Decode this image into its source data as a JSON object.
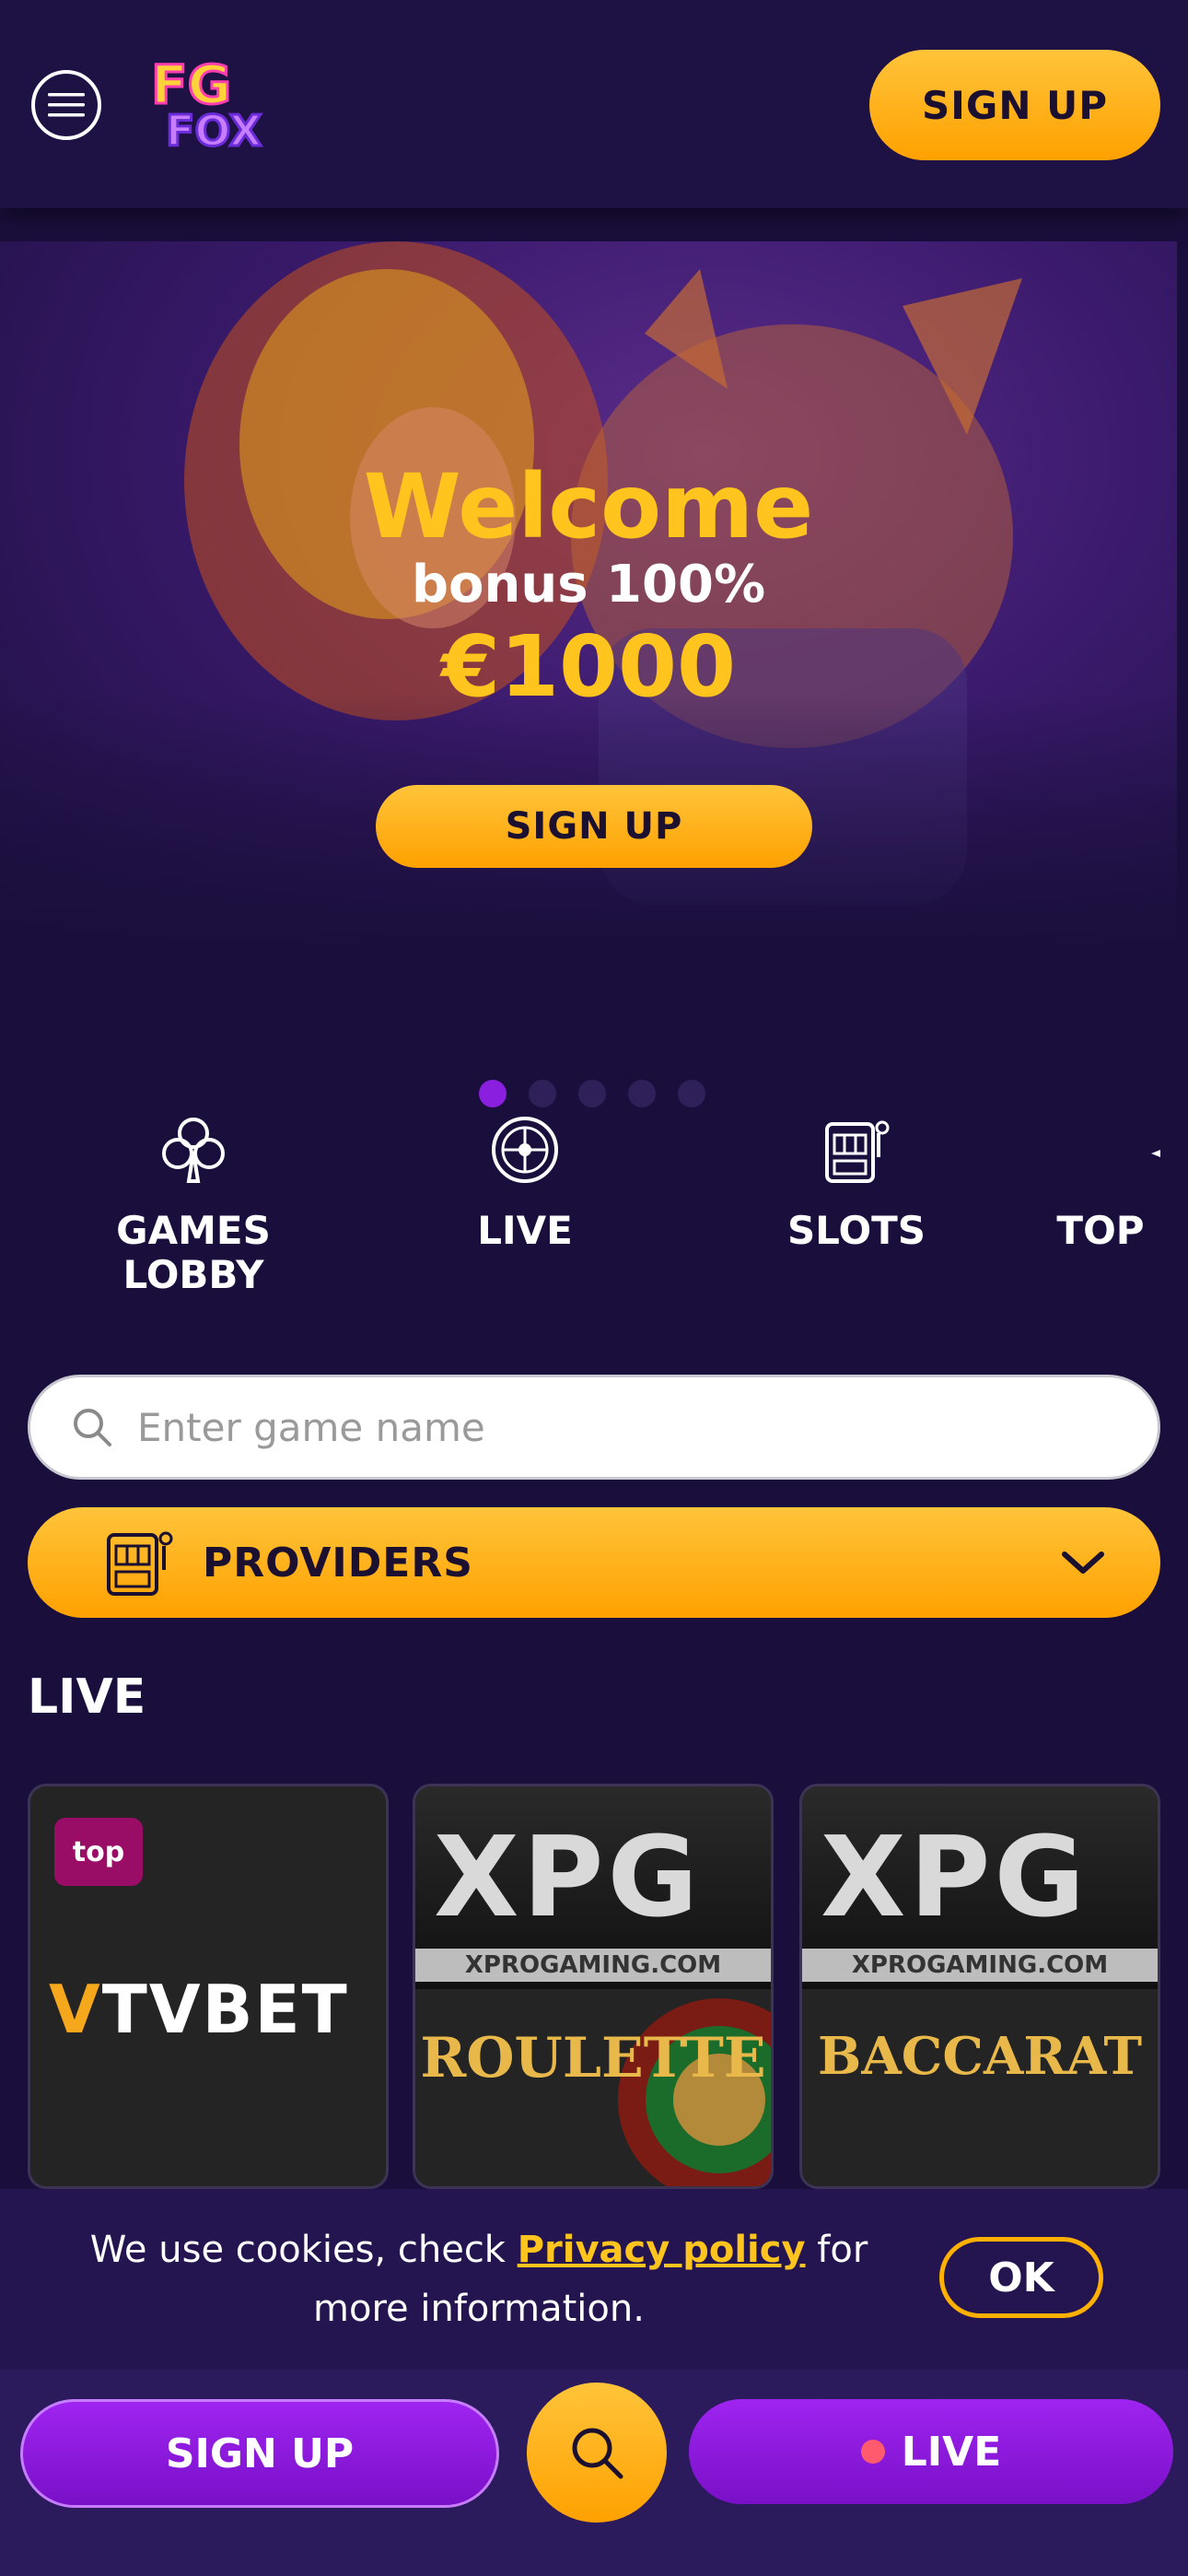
{
  "header": {
    "logo_text_top": "FG",
    "logo_text_bottom": "FOX",
    "signup_label": "SIGN UP"
  },
  "hero": {
    "welcome": "Welcome",
    "bonus": "bonus 100%",
    "amount": "€1000",
    "signup_label": "SIGN UP",
    "slides_total": 5,
    "active_slide": 1
  },
  "categories": [
    {
      "label": "GAMES LOBBY",
      "icon": "club-icon"
    },
    {
      "label": "LIVE",
      "icon": "roulette-icon"
    },
    {
      "label": "SLOTS",
      "icon": "slot-machine-icon"
    },
    {
      "label": "TOP",
      "icon": "star-icon"
    }
  ],
  "search": {
    "placeholder": "Enter game name"
  },
  "providers": {
    "label": "PROVIDERS"
  },
  "live_section": {
    "title": "LIVE",
    "cards": [
      {
        "badge": "top",
        "brand": "TVBET"
      },
      {
        "brand": "XPG",
        "site": "XPROGAMING.COM",
        "game": "ROULETTE"
      },
      {
        "brand": "XPG",
        "site": "XPROGAMING.COM",
        "game": "BACCARAT"
      }
    ]
  },
  "cookie": {
    "text_before": "We use cookies, check ",
    "link": "Privacy policy",
    "text_after": " for more information.",
    "ok_label": "OK"
  },
  "bottom_bar": {
    "signup_label": "SIGN UP",
    "live_label": "LIVE"
  },
  "colors": {
    "background": "#1a0f3c",
    "accent_yellow": "#ffb000",
    "accent_purple": "#8b1fe0"
  }
}
